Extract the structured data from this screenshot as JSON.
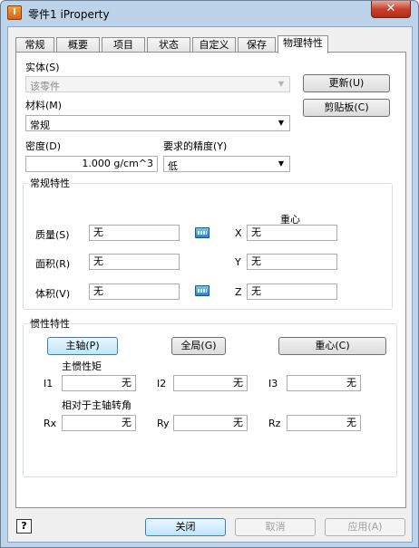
{
  "window": {
    "title": "零件1 iProperty",
    "close_glyph": "✕"
  },
  "tabs": [
    {
      "label": "常规"
    },
    {
      "label": "概要"
    },
    {
      "label": "项目"
    },
    {
      "label": "状态"
    },
    {
      "label": "自定义"
    },
    {
      "label": "保存"
    },
    {
      "label": "物理特性"
    }
  ],
  "physical": {
    "solid_label": "实体(S)",
    "solid_value": "该零件",
    "material_label": "材料(M)",
    "material_value": "常规",
    "update_button": "更新(U)",
    "clipboard_button": "剪贴板(C)",
    "density_label": "密度(D)",
    "density_value": "1.000 g/cm^3",
    "accuracy_label": "要求的精度(Y)",
    "accuracy_value": "低"
  },
  "general_props": {
    "title": "常规特性",
    "center_of_gravity_label": "重心",
    "mass_label": "质量(S)",
    "mass_value": "无",
    "area_label": "面积(R)",
    "area_value": "无",
    "volume_label": "体积(V)",
    "volume_value": "无",
    "x_label": "X",
    "x_value": "无",
    "y_label": "Y",
    "y_value": "无",
    "z_label": "Z",
    "z_value": "无"
  },
  "inertial": {
    "title": "惯性特性",
    "principal_button": "主轴(P)",
    "global_button": "全局(G)",
    "cog_button": "重心(C)",
    "principal_moments_label": "主惯性矩",
    "i1_label": "I1",
    "i1_value": "无",
    "i2_label": "I2",
    "i2_value": "无",
    "i3_label": "I3",
    "i3_value": "无",
    "rotation_label": "相对于主轴转角",
    "rx_label": "Rx",
    "rx_value": "无",
    "ry_label": "Ry",
    "ry_value": "无",
    "rz_label": "Rz",
    "rz_value": "无"
  },
  "footer": {
    "help_label": "?",
    "close_button": "关闭",
    "cancel_button": "取消",
    "apply_button": "应用(A)"
  }
}
